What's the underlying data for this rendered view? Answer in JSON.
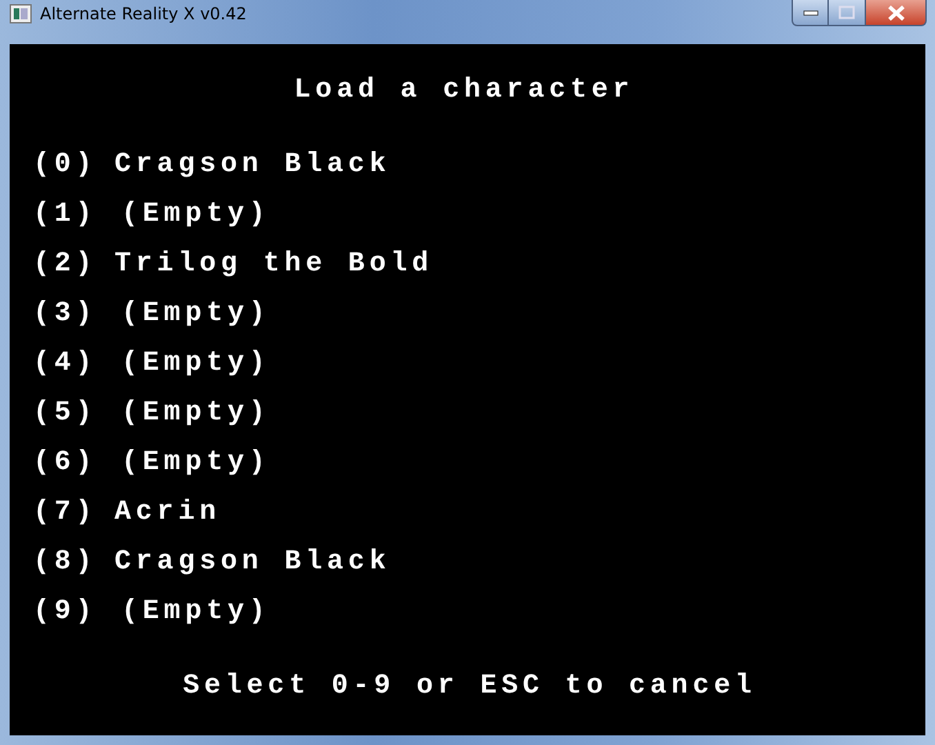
{
  "window": {
    "title": "Alternate Reality X v0.42"
  },
  "heading": "Load a character",
  "slots": [
    {
      "key": "(0)",
      "name": "Cragson Black",
      "kind": "character"
    },
    {
      "key": "(1)",
      "name": "(Empty)",
      "kind": "empty"
    },
    {
      "key": "(2)",
      "name": "Trilog the Bold",
      "kind": "character"
    },
    {
      "key": "(3)",
      "name": "(Empty)",
      "kind": "empty"
    },
    {
      "key": "(4)",
      "name": "(Empty)",
      "kind": "empty"
    },
    {
      "key": "(5)",
      "name": "(Empty)",
      "kind": "empty"
    },
    {
      "key": "(6)",
      "name": "(Empty)",
      "kind": "empty"
    },
    {
      "key": "(7)",
      "name": "Acrin",
      "kind": "character"
    },
    {
      "key": "(8)",
      "name": "Cragson Black",
      "kind": "character"
    },
    {
      "key": "(9)",
      "name": "(Empty)",
      "kind": "empty"
    }
  ],
  "prompt": "Select 0-9 or ESC to cancel"
}
